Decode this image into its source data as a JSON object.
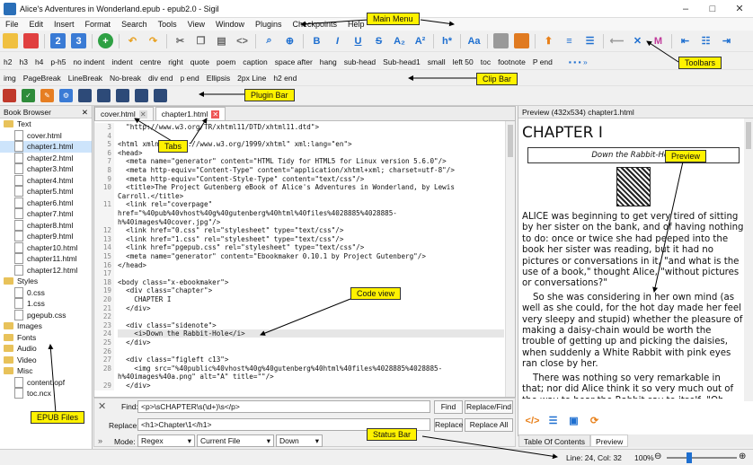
{
  "window": {
    "title": "Alice's Adventures in Wonderland.epub - epub2.0 - Sigil"
  },
  "menu": [
    "File",
    "Edit",
    "Insert",
    "Format",
    "Search",
    "Tools",
    "View",
    "Window",
    "Plugins",
    "Checkpoints",
    "Help"
  ],
  "clip_bar_1": [
    "h2",
    "h3",
    "h4",
    "p-h5",
    "no indent",
    "indent",
    "centre",
    "right",
    "quote",
    "poem",
    "caption",
    "space after",
    "hang",
    "sub-head",
    "Sub-head1",
    "small",
    "left 50",
    "toc",
    "footnote",
    "P end"
  ],
  "clip_bar_2": [
    "img",
    "PageBreak",
    "LineBreak",
    "No-break",
    "div end",
    "p end",
    "Ellipsis",
    "2px Line",
    "h2 end"
  ],
  "book_browser": {
    "header": "Book Browser",
    "items": [
      {
        "label": "Text",
        "type": "folder"
      },
      {
        "label": "cover.html",
        "type": "file"
      },
      {
        "label": "chapter1.html",
        "type": "file"
      },
      {
        "label": "chapter2.html",
        "type": "file"
      },
      {
        "label": "chapter3.html",
        "type": "file"
      },
      {
        "label": "chapter4.html",
        "type": "file"
      },
      {
        "label": "chapter5.html",
        "type": "file"
      },
      {
        "label": "chapter6.html",
        "type": "file"
      },
      {
        "label": "chapter7.html",
        "type": "file"
      },
      {
        "label": "chapter8.html",
        "type": "file"
      },
      {
        "label": "chapter9.html",
        "type": "file"
      },
      {
        "label": "chapter10.html",
        "type": "file"
      },
      {
        "label": "chapter11.html",
        "type": "file"
      },
      {
        "label": "chapter12.html",
        "type": "file"
      },
      {
        "label": "Styles",
        "type": "folder"
      },
      {
        "label": "0.css",
        "type": "file"
      },
      {
        "label": "1.css",
        "type": "file"
      },
      {
        "label": "pgepub.css",
        "type": "file"
      },
      {
        "label": "Images",
        "type": "folder"
      },
      {
        "label": "Fonts",
        "type": "folder"
      },
      {
        "label": "Audio",
        "type": "folder"
      },
      {
        "label": "Video",
        "type": "folder"
      },
      {
        "label": "Misc",
        "type": "folder"
      },
      {
        "label": "content.opf",
        "type": "file"
      },
      {
        "label": "toc.ncx",
        "type": "file"
      }
    ]
  },
  "tabs": [
    {
      "label": "cover.html"
    },
    {
      "label": "chapter1.html"
    }
  ],
  "code_lines": [
    {
      "n": "3",
      "t": "  \"http://www.w3.org/TR/xhtml11/DTD/xhtml11.dtd\">"
    },
    {
      "n": "4",
      "t": ""
    },
    {
      "n": "5",
      "t": "<html xmlns=\"http://www.w3.org/1999/xhtml\" xml:lang=\"en\">"
    },
    {
      "n": "6",
      "t": "<head>"
    },
    {
      "n": "7",
      "t": "  <meta name=\"generator\" content=\"HTML Tidy for HTML5 for Linux version 5.6.0\"/>"
    },
    {
      "n": "8",
      "t": "  <meta http-equiv=\"Content-Type\" content=\"application/xhtml+xml; charset=utf-8\"/>"
    },
    {
      "n": "9",
      "t": "  <meta http-equiv=\"Content-Style-Type\" content=\"text/css\"/>"
    },
    {
      "n": "10",
      "t": "  <title>The Project Gutenberg eBook of Alice's Adventures in Wonderland, by Lewis"
    },
    {
      "n": "",
      "t": "Carroll.</title>"
    },
    {
      "n": "11",
      "t": "  <link rel=\"coverpage\""
    },
    {
      "n": "",
      "t": "href=\"%40pub%40vhost%40g%40gutenberg%40html%40files%4028885%4028885-"
    },
    {
      "n": "",
      "t": "h%40images%40cover.jpg\"/>"
    },
    {
      "n": "12",
      "t": "  <link href=\"0.css\" rel=\"stylesheet\" type=\"text/css\"/>"
    },
    {
      "n": "13",
      "t": "  <link href=\"1.css\" rel=\"stylesheet\" type=\"text/css\"/>"
    },
    {
      "n": "14",
      "t": "  <link href=\"pgepub.css\" rel=\"stylesheet\" type=\"text/css\"/>"
    },
    {
      "n": "15",
      "t": "  <meta name=\"generator\" content=\"Ebookmaker 0.10.1 by Project Gutenberg\"/>"
    },
    {
      "n": "16",
      "t": "</head>"
    },
    {
      "n": "17",
      "t": ""
    },
    {
      "n": "18",
      "t": "<body class=\"x-ebookmaker\">"
    },
    {
      "n": "19",
      "t": "  <div class=\"chapter\">"
    },
    {
      "n": "20",
      "t": "    CHAPTER I"
    },
    {
      "n": "21",
      "t": "  </div>"
    },
    {
      "n": "22",
      "t": ""
    },
    {
      "n": "23",
      "t": "  <div class=\"sidenote\">"
    },
    {
      "n": "24",
      "t": "    <i>Down the Rabbit-Hole</i>"
    },
    {
      "n": "25",
      "t": "  </div>"
    },
    {
      "n": "26",
      "t": ""
    },
    {
      "n": "27",
      "t": "  <div class=\"figleft c13\">"
    },
    {
      "n": "28",
      "t": "    <img src=\"%40public%40vhost%40g%40gutenberg%40html%40files%4028885%4028885-"
    },
    {
      "n": "",
      "t": "h%40images%40a.png\" alt=\"A\" title=\"\"/>"
    },
    {
      "n": "29",
      "t": "  </div>"
    }
  ],
  "find": {
    "find_label": "Find:",
    "find_value": "<p>\\sCHAPTER\\s(\\d+)\\s</p>",
    "replace_label": "Replace:",
    "replace_value": "<h1>Chapter\\1</h1>",
    "find_button": "Find",
    "replace_find_button": "Replace/Find",
    "replace_button": "Replace",
    "replace_all_button": "Replace All",
    "mode_label": "Mode:",
    "mode_value": "Regex",
    "scope_value": "Current File",
    "direction_value": "Down"
  },
  "preview": {
    "header": "Preview (432x534) chapter1.html",
    "heading": "CHAPTER I",
    "subhead": "Down the Rabbit-Hole",
    "p1": "ALICE was beginning to get very tired of sitting by her sister on the bank, and of having nothing to do: once or twice she had peeped into the book her sister was reading, but it had no pictures or conversations in it, \"and what is the use of a book,\" thought Alice, \"without pictures or conversations?\"",
    "p2": "So she was considering in her own mind (as well as she could, for the hot day made her feel very sleepy and stupid) whether the pleasure of making a daisy-chain would be worth the trouble of getting up and picking the daisies, when suddenly a White Rabbit with pink eyes ran close by her.",
    "p3": "There was nothing so very remarkable in that; nor did Alice think it so very much out of the way to hear the Rabbit say to itself, \"Oh dear! Oh dear! I shall be too late!\" (when she thought it",
    "tab_toc": "Table Of Contents",
    "tab_preview": "Preview"
  },
  "status": {
    "position": "Line: 24, Col: 32",
    "zoom": "100%"
  },
  "callouts": {
    "main_menu": "Main Menu",
    "toolbars": "Toolbars",
    "clip_bar": "Clip Bar",
    "plugin_bar": "Plugin Bar",
    "tabs": "Tabs",
    "preview": "Preview",
    "code_view": "Code view",
    "epub_files": "EPUB Files",
    "status_bar": "Status Bar"
  },
  "colors": {
    "callout": "#fff200",
    "selected_file": "#cde4fb"
  }
}
